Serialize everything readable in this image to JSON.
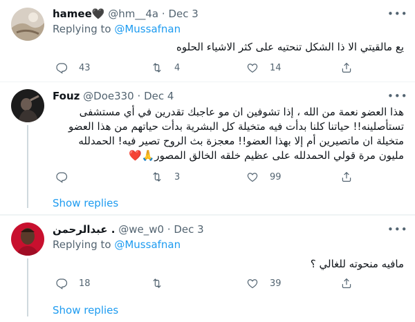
{
  "tweets": [
    {
      "name": "hamee🖤",
      "handle": "@hm__4a",
      "sep": "·",
      "date": "Dec 3",
      "replying_prefix": "Replying to",
      "replying_to": "@Mussafnan",
      "text": "يع مالقيتي الا ذا الشكل تنحتيه على كثر الاشياء الحلوه",
      "replies": "43",
      "retweets": "4",
      "likes": "14"
    },
    {
      "name": "Fouz",
      "handle": "@Doe330",
      "sep": "·",
      "date": "Dec 4",
      "text": "هذا العضو نعمة من الله ، إذا تشوفين ان مو عاجبك تقدرين في أي مستشفى تستأصلينه!! حياتنا كلنا بدأت فيه متخيلة كل البشرية بدأت حياتهم من هذا العضو متخيلة ان ماتصيرين أم إلا بهذا العضو!! معجزة بث الروح تصير فيه! الحمدلله مليون مرة قولي الحمدلله على عظيم خلقه الخالق المصور🙏❤️",
      "replies": "",
      "retweets": "3",
      "likes": "99",
      "show_replies": "Show replies"
    },
    {
      "name": "عبدالرحمن .",
      "handle": "@we_w0",
      "sep": "·",
      "date": "Dec 3",
      "replying_prefix": "Replying to",
      "replying_to": "@Mussafnan",
      "text": "مافيه منحوته للغالي ؟",
      "replies": "18",
      "retweets": "",
      "likes": "39",
      "show_replies": "Show replies"
    }
  ],
  "icons": {
    "reply": "reply-icon",
    "retweet": "retweet-icon",
    "like": "like-icon",
    "share": "share-icon",
    "more": "more-icon"
  },
  "colors": {
    "link": "#1d9bf0",
    "secondary_text": "#536471",
    "divider": "#eff3f4",
    "thread_line": "#cfd9de"
  }
}
